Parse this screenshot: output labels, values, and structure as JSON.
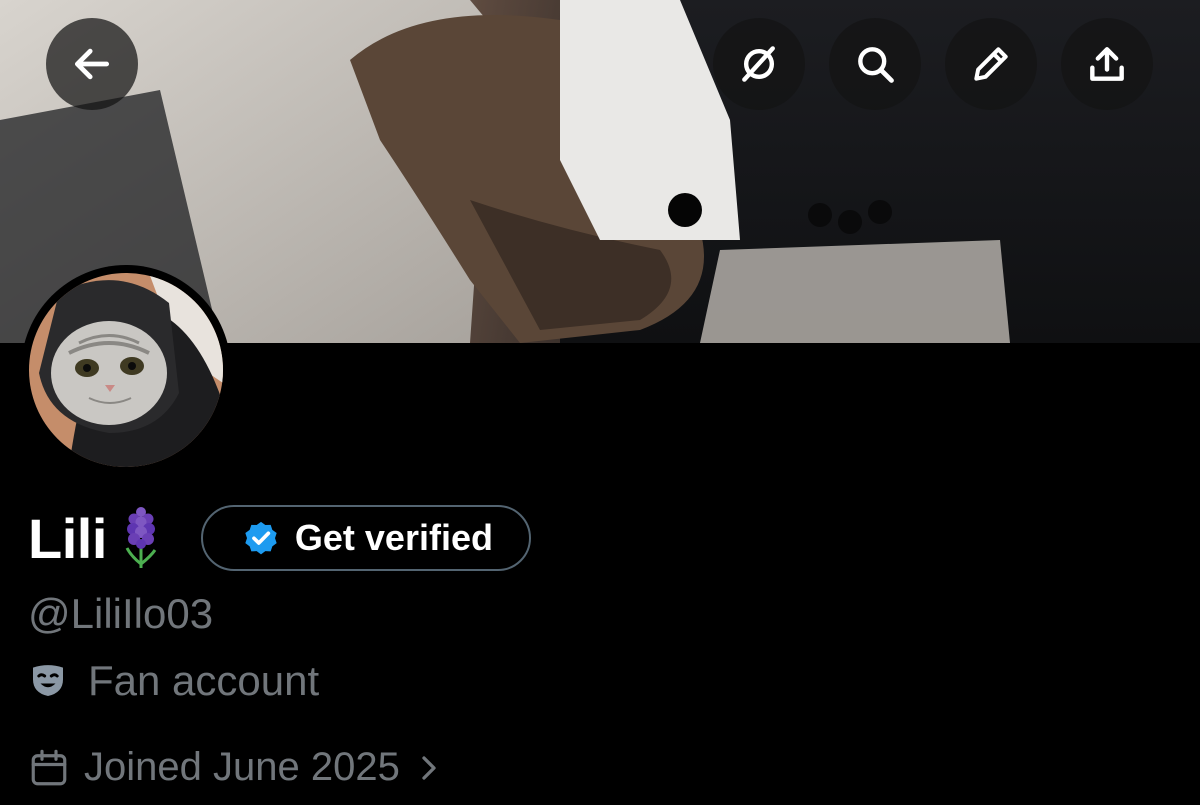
{
  "header": {
    "back_icon": "arrow-left-icon",
    "actions": [
      "grok-icon",
      "search-icon",
      "edit-icon",
      "share-icon"
    ]
  },
  "profile": {
    "name": "Lili",
    "name_emoji": "hyacinth",
    "verify_label": "Get verified",
    "handle": "@LiliIlo03",
    "category_icon": "performing-arts-icon",
    "category": "Fan account",
    "joined": "Joined June 2025",
    "joined_icon": "calendar-icon"
  },
  "colors": {
    "background": "#000000",
    "text_primary": "#ffffff",
    "text_secondary": "#71767b",
    "verified_blue": "#1d9bf0",
    "button_border": "#536471"
  }
}
